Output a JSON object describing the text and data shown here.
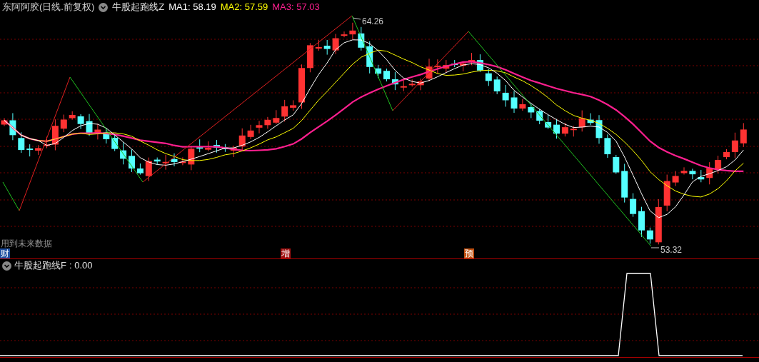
{
  "header": {
    "stock_title": "东阿阿胶(日线.前复权)",
    "indicator_name": "牛股起跑线Z",
    "ma_readings": [
      {
        "label": "MA1: 58.19",
        "color": "#ffffff"
      },
      {
        "label": "MA2: 57.59",
        "color": "#ffff00"
      },
      {
        "label": "MA3: 57.03",
        "color": "#ff1f8f"
      }
    ]
  },
  "price_chart": {
    "high_label": "64.26",
    "low_label": "53.32",
    "note": "用到未来数据"
  },
  "event_markers": [
    {
      "label": "财",
      "color": "#1e4fa0"
    },
    {
      "label": "增",
      "color": "#a01010"
    },
    {
      "label": "预",
      "color": "#c05010"
    }
  ],
  "lower_panel": {
    "indicator_name": "牛股起跑线F",
    "reading": ": 0.00"
  }
}
